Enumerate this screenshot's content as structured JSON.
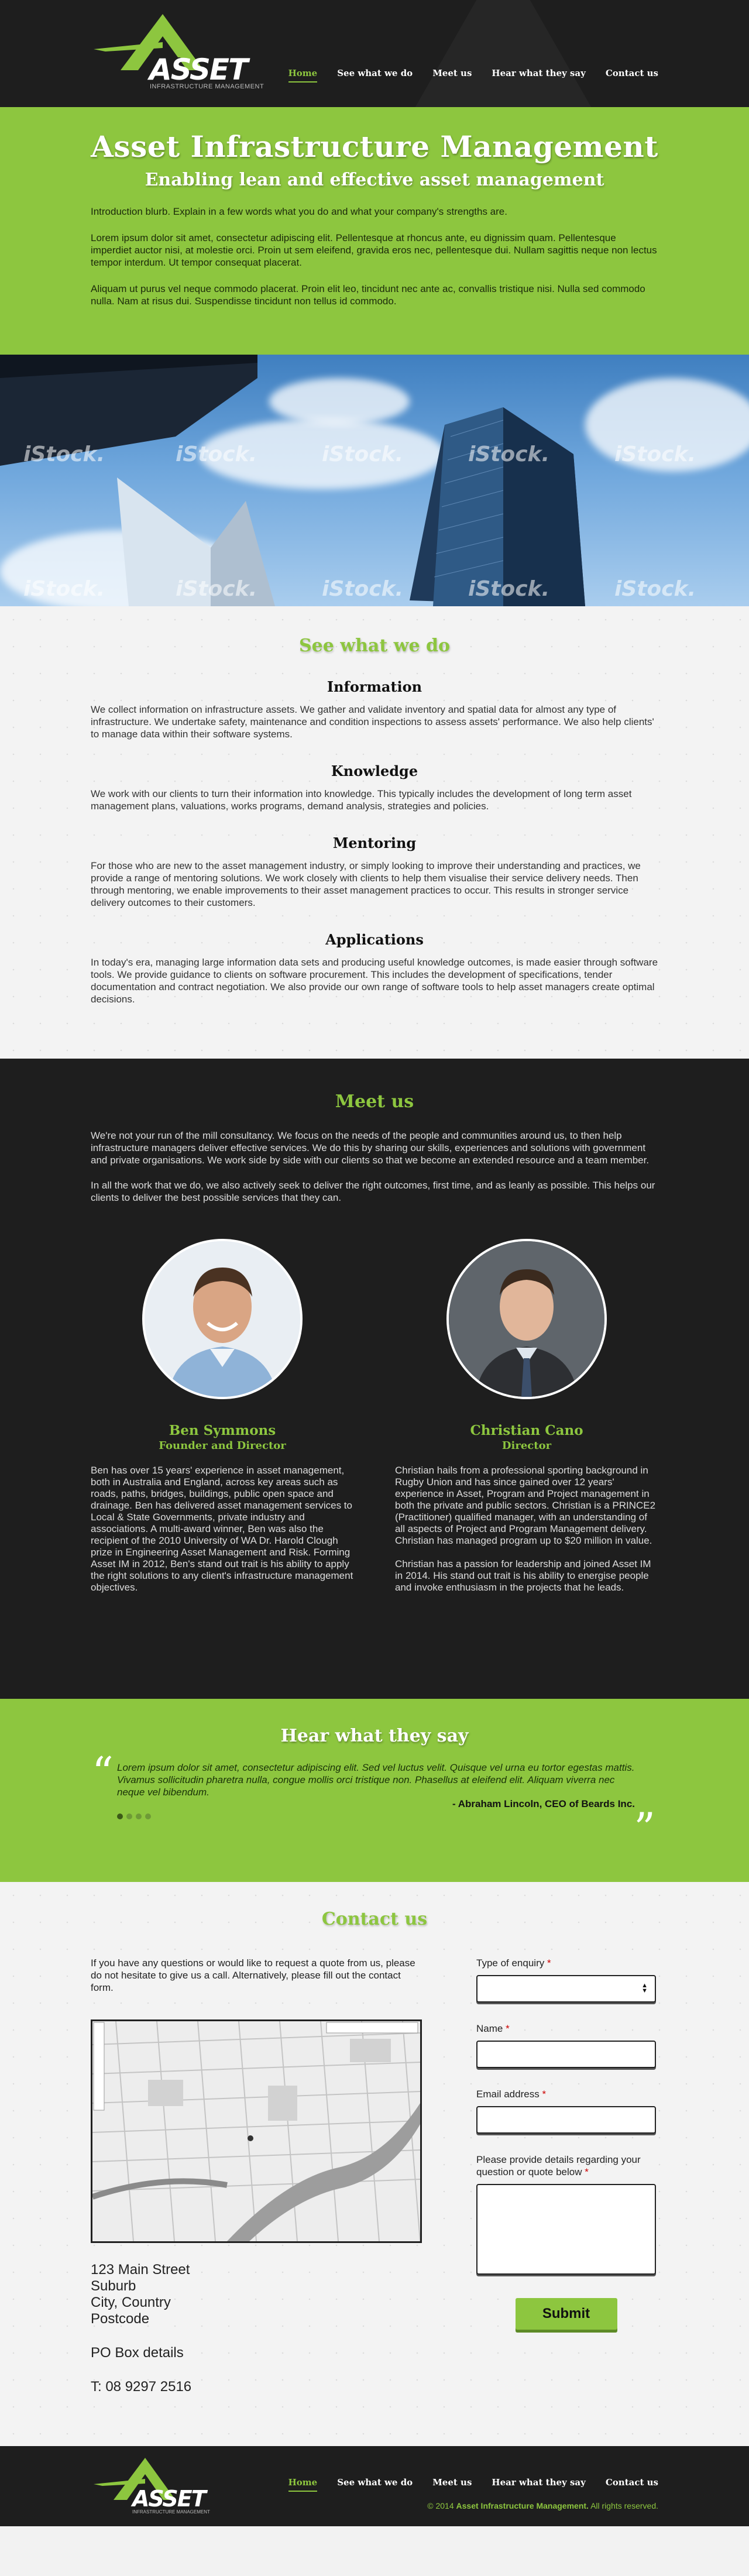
{
  "brand": {
    "logo_text": "ASSET",
    "logo_subtitle": "INFRASTRUCTURE MANAGEMENT",
    "accent_color": "#8dc63f",
    "dark_color": "#1e1e1e"
  },
  "nav": {
    "items": [
      {
        "label": "Home",
        "active": true
      },
      {
        "label": "See what we do",
        "active": false
      },
      {
        "label": "Meet us",
        "active": false
      },
      {
        "label": "Hear what they say",
        "active": false
      },
      {
        "label": "Contact us",
        "active": false
      }
    ]
  },
  "intro": {
    "title": "Asset Infrastructure Management",
    "subtitle": "Enabling lean and effective asset management",
    "paragraphs": [
      "Introduction blurb. Explain in a few words what you do and what your company's strengths are.",
      "Lorem ipsum dolor sit amet, consectetur adipiscing elit. Pellentesque at rhoncus ante, eu dignissim quam. Pellentesque imperdiet auctor nisi, at molestie orci. Proin ut sem eleifend, gravida eros nec, pellentesque dui. Nullam sagittis neque non lectus tempor interdum. Ut tempor consequat placerat.",
      "Aliquam ut purus vel neque commodo placerat. Proin elit leo, tincidunt nec ante ac, convallis tristique nisi. Nulla sed commodo nulla. Nam at risus dui. Suspendisse tincidunt non tellus id commodo."
    ]
  },
  "banner": {
    "watermark": "iStock."
  },
  "services": {
    "title": "See what we do",
    "items": [
      {
        "heading": "Information",
        "text": "We collect information on infrastructure assets. We gather and validate inventory and spatial data for almost any type of infrastructure. We undertake safety, maintenance and condition inspections to assess assets' performance. We also help clients' to manage data within their software systems."
      },
      {
        "heading": "Knowledge",
        "text": "We work with our clients to turn their information into knowledge. This typically includes the development of long term asset management plans, valuations, works programs, demand analysis, strategies and policies."
      },
      {
        "heading": "Mentoring",
        "text": "For those who are new to the asset management industry, or simply looking to improve their understanding and practices, we provide a range of mentoring solutions. We work closely with clients to help them visualise their service delivery needs. Then through mentoring, we enable improvements to their asset management practices to occur. This results in stronger service delivery outcomes to their customers."
      },
      {
        "heading": "Applications",
        "text": "In today's era, managing large information data sets and producing useful knowledge outcomes, is made easier through software tools. We provide guidance to clients on software procurement. This includes the development of specifications, tender documentation and contract negotiation. We also provide our own range of software tools to help asset managers create optimal decisions."
      }
    ]
  },
  "meet": {
    "title": "Meet us",
    "paragraphs": [
      "We're not your run of the mill consultancy. We focus on the needs of the people and communities around us, to then help infrastructure managers deliver effective services. We do this by sharing our skills, experiences and solutions with government and private organisations. We work side by side with our clients so that we become an extended resource and a team member.",
      "In all the work that we do, we also actively seek to deliver the right outcomes, first time, and as leanly as possible. This helps our clients to deliver the best possible services that they can."
    ],
    "people": [
      {
        "name": "Ben Symmons",
        "role": "Founder and Director",
        "bio": [
          "Ben has over 15 years' experience in asset management, both in Australia and England, across key areas such as roads, paths, bridges, buildings, public open space and drainage. Ben has delivered asset management services to Local & State Governments, private industry and associations. A multi-award winner, Ben was also the recipient of the 2010 University of WA Dr. Harold Clough prize in Engineering Asset Management and Risk. Forming Asset IM in 2012, Ben's stand out trait is his ability to apply the right solutions to any client's infrastructure management objectives."
        ]
      },
      {
        "name": "Christian Cano",
        "role": "Director",
        "bio": [
          "Christian hails from a professional sporting background in Rugby Union and has since gained over 12 years' experience in Asset, Program and Project management in both the private and public sectors. Christian is a PRINCE2 (Practitioner) qualified manager, with an understanding of all aspects of Project and Program Management delivery. Christian has managed program up to $20 million in value.",
          "Christian has a passion for leadership and joined Asset IM in 2014. His stand out trait is his ability to energise people and invoke enthusiasm in the projects that he leads."
        ]
      }
    ]
  },
  "testimonial": {
    "title": "Hear what they say",
    "quote": "Lorem ipsum dolor sit amet, consectetur adipiscing elit. Sed vel luctus velit. Quisque vel urna eu tortor egestas mattis. Vivamus sollicitudin pharetra nulla, congue mollis orci tristique non. Phasellus at eleifend elit. Aliquam viverra nec neque vel bibendum.",
    "author": "- Abraham Lincoln, CEO of Beards Inc.",
    "slides": 4,
    "active_slide": 1
  },
  "contact": {
    "title": "Contact us",
    "intro": "If you have any questions or would like to request a quote from us, please do not hesitate to give us a call. Alternatively, please fill out the contact form.",
    "address_lines": [
      "123 Main Street",
      "Suburb",
      "City, Country",
      "Postcode"
    ],
    "po_box": "PO Box details",
    "phone": "T: 08 9297 2516",
    "form": {
      "enquiry_label": "Type of enquiry",
      "name_label": "Name",
      "email_label": "Email address",
      "details_label": "Please provide details regarding your question or quote below",
      "required_marker": "*",
      "submit_label": "Submit"
    }
  },
  "footer": {
    "copyright_prefix": "© 2014",
    "copyright_company": "Asset Infrastructure Management.",
    "copyright_suffix": "All rights reserved."
  }
}
